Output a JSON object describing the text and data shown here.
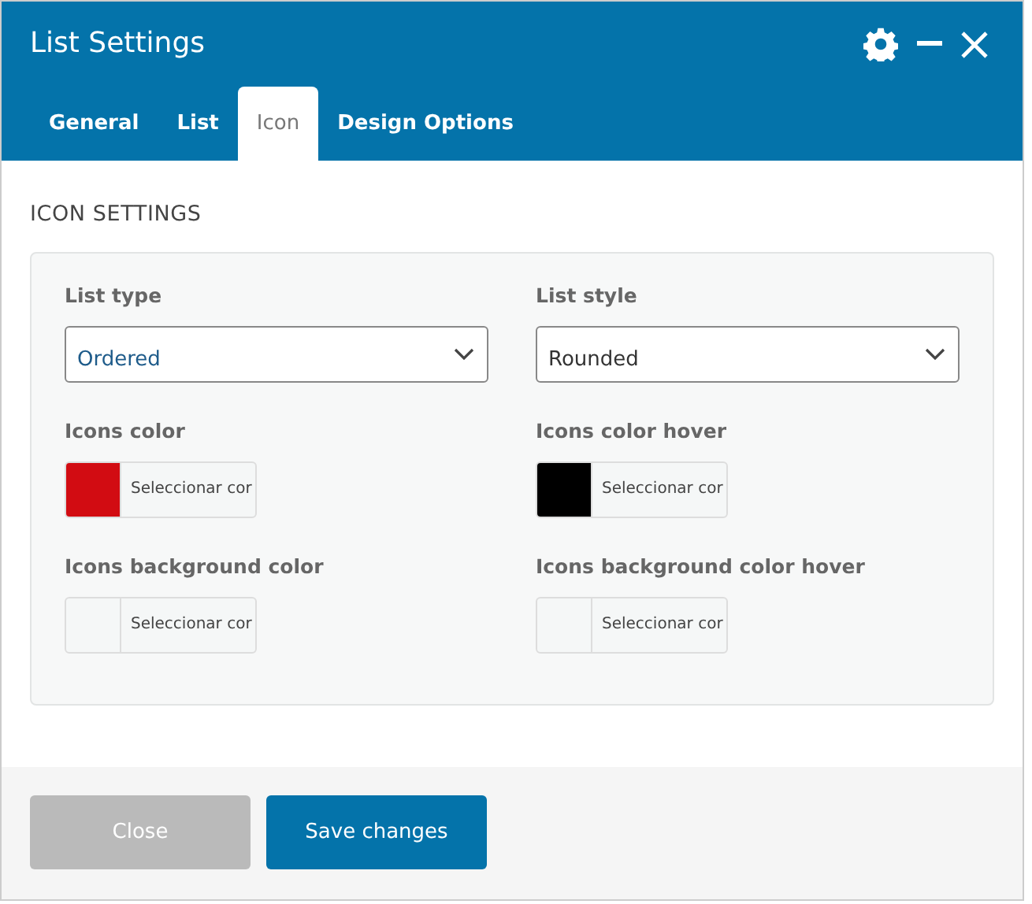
{
  "window": {
    "title": "List Settings"
  },
  "tabs": [
    {
      "label": "General",
      "selected": false
    },
    {
      "label": "List",
      "selected": false
    },
    {
      "label": "Icon",
      "selected": true
    },
    {
      "label": "Design Options",
      "selected": false
    }
  ],
  "section_title": "ICON SETTINGS",
  "fields": [
    {
      "kind": "select",
      "label": "List type",
      "value": "Ordered",
      "focused": true
    },
    {
      "kind": "select",
      "label": "List style",
      "value": "Rounded",
      "focused": false
    },
    {
      "kind": "color",
      "label": "Icons color",
      "button": "Seleccionar cor",
      "color": "#d20c12"
    },
    {
      "kind": "color",
      "label": "Icons color hover",
      "button": "Seleccionar cor",
      "color": "#000000"
    },
    {
      "kind": "color",
      "label": "Icons background color",
      "button": "Seleccionar cor"
    },
    {
      "kind": "color",
      "label": "Icons background color hover",
      "button": "Seleccionar cor"
    }
  ],
  "buttons": [
    {
      "label": "Close",
      "kind": "secondary"
    },
    {
      "label": "Save changes",
      "kind": "primary"
    }
  ]
}
